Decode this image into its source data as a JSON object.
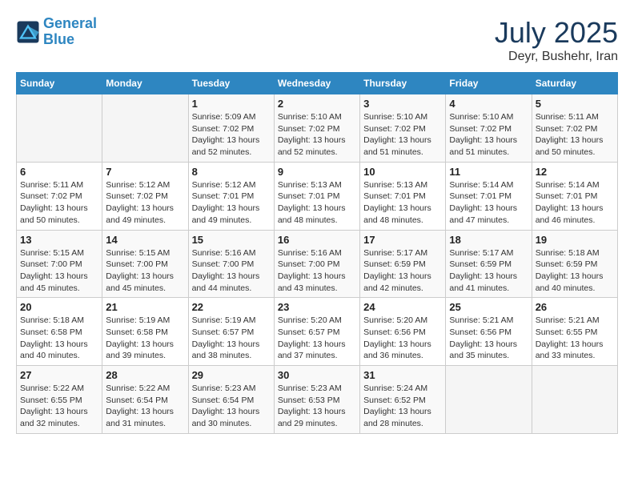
{
  "logo": {
    "line1": "General",
    "line2": "Blue"
  },
  "title": "July 2025",
  "subtitle": "Deyr, Bushehr, Iran",
  "days_of_week": [
    "Sunday",
    "Monday",
    "Tuesday",
    "Wednesday",
    "Thursday",
    "Friday",
    "Saturday"
  ],
  "weeks": [
    [
      {
        "day": "",
        "info": ""
      },
      {
        "day": "",
        "info": ""
      },
      {
        "day": "1",
        "info": "Sunrise: 5:09 AM\nSunset: 7:02 PM\nDaylight: 13 hours and 52 minutes."
      },
      {
        "day": "2",
        "info": "Sunrise: 5:10 AM\nSunset: 7:02 PM\nDaylight: 13 hours and 52 minutes."
      },
      {
        "day": "3",
        "info": "Sunrise: 5:10 AM\nSunset: 7:02 PM\nDaylight: 13 hours and 51 minutes."
      },
      {
        "day": "4",
        "info": "Sunrise: 5:10 AM\nSunset: 7:02 PM\nDaylight: 13 hours and 51 minutes."
      },
      {
        "day": "5",
        "info": "Sunrise: 5:11 AM\nSunset: 7:02 PM\nDaylight: 13 hours and 50 minutes."
      }
    ],
    [
      {
        "day": "6",
        "info": "Sunrise: 5:11 AM\nSunset: 7:02 PM\nDaylight: 13 hours and 50 minutes."
      },
      {
        "day": "7",
        "info": "Sunrise: 5:12 AM\nSunset: 7:02 PM\nDaylight: 13 hours and 49 minutes."
      },
      {
        "day": "8",
        "info": "Sunrise: 5:12 AM\nSunset: 7:01 PM\nDaylight: 13 hours and 49 minutes."
      },
      {
        "day": "9",
        "info": "Sunrise: 5:13 AM\nSunset: 7:01 PM\nDaylight: 13 hours and 48 minutes."
      },
      {
        "day": "10",
        "info": "Sunrise: 5:13 AM\nSunset: 7:01 PM\nDaylight: 13 hours and 48 minutes."
      },
      {
        "day": "11",
        "info": "Sunrise: 5:14 AM\nSunset: 7:01 PM\nDaylight: 13 hours and 47 minutes."
      },
      {
        "day": "12",
        "info": "Sunrise: 5:14 AM\nSunset: 7:01 PM\nDaylight: 13 hours and 46 minutes."
      }
    ],
    [
      {
        "day": "13",
        "info": "Sunrise: 5:15 AM\nSunset: 7:00 PM\nDaylight: 13 hours and 45 minutes."
      },
      {
        "day": "14",
        "info": "Sunrise: 5:15 AM\nSunset: 7:00 PM\nDaylight: 13 hours and 45 minutes."
      },
      {
        "day": "15",
        "info": "Sunrise: 5:16 AM\nSunset: 7:00 PM\nDaylight: 13 hours and 44 minutes."
      },
      {
        "day": "16",
        "info": "Sunrise: 5:16 AM\nSunset: 7:00 PM\nDaylight: 13 hours and 43 minutes."
      },
      {
        "day": "17",
        "info": "Sunrise: 5:17 AM\nSunset: 6:59 PM\nDaylight: 13 hours and 42 minutes."
      },
      {
        "day": "18",
        "info": "Sunrise: 5:17 AM\nSunset: 6:59 PM\nDaylight: 13 hours and 41 minutes."
      },
      {
        "day": "19",
        "info": "Sunrise: 5:18 AM\nSunset: 6:59 PM\nDaylight: 13 hours and 40 minutes."
      }
    ],
    [
      {
        "day": "20",
        "info": "Sunrise: 5:18 AM\nSunset: 6:58 PM\nDaylight: 13 hours and 40 minutes."
      },
      {
        "day": "21",
        "info": "Sunrise: 5:19 AM\nSunset: 6:58 PM\nDaylight: 13 hours and 39 minutes."
      },
      {
        "day": "22",
        "info": "Sunrise: 5:19 AM\nSunset: 6:57 PM\nDaylight: 13 hours and 38 minutes."
      },
      {
        "day": "23",
        "info": "Sunrise: 5:20 AM\nSunset: 6:57 PM\nDaylight: 13 hours and 37 minutes."
      },
      {
        "day": "24",
        "info": "Sunrise: 5:20 AM\nSunset: 6:56 PM\nDaylight: 13 hours and 36 minutes."
      },
      {
        "day": "25",
        "info": "Sunrise: 5:21 AM\nSunset: 6:56 PM\nDaylight: 13 hours and 35 minutes."
      },
      {
        "day": "26",
        "info": "Sunrise: 5:21 AM\nSunset: 6:55 PM\nDaylight: 13 hours and 33 minutes."
      }
    ],
    [
      {
        "day": "27",
        "info": "Sunrise: 5:22 AM\nSunset: 6:55 PM\nDaylight: 13 hours and 32 minutes."
      },
      {
        "day": "28",
        "info": "Sunrise: 5:22 AM\nSunset: 6:54 PM\nDaylight: 13 hours and 31 minutes."
      },
      {
        "day": "29",
        "info": "Sunrise: 5:23 AM\nSunset: 6:54 PM\nDaylight: 13 hours and 30 minutes."
      },
      {
        "day": "30",
        "info": "Sunrise: 5:23 AM\nSunset: 6:53 PM\nDaylight: 13 hours and 29 minutes."
      },
      {
        "day": "31",
        "info": "Sunrise: 5:24 AM\nSunset: 6:52 PM\nDaylight: 13 hours and 28 minutes."
      },
      {
        "day": "",
        "info": ""
      },
      {
        "day": "",
        "info": ""
      }
    ]
  ]
}
